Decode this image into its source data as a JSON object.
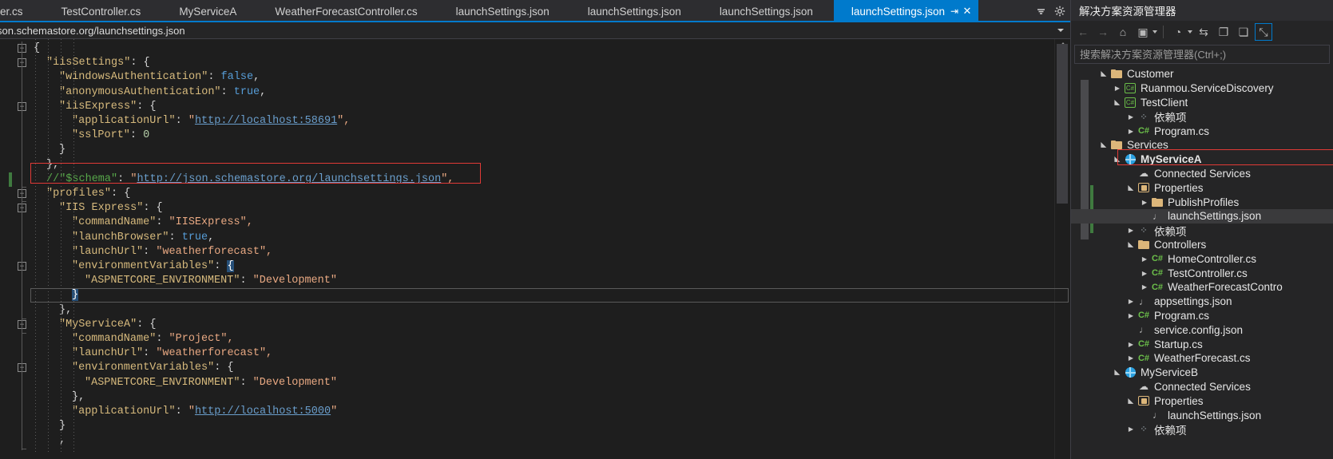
{
  "editor": {
    "tabs": [
      {
        "label": "ller.cs",
        "active": false,
        "truncated": true
      },
      {
        "label": "TestController.cs",
        "active": false
      },
      {
        "label": "MyServiceA",
        "active": false
      },
      {
        "label": "WeatherForecastController.cs",
        "active": false
      },
      {
        "label": "launchSettings.json",
        "active": false
      },
      {
        "label": "launchSettings.json",
        "active": false
      },
      {
        "label": "launchSettings.json",
        "active": false
      },
      {
        "label": "launchSettings.json",
        "active": true,
        "pin": "⇥",
        "close": "✕"
      }
    ],
    "tab_overflow_icon": "chevron-down-icon",
    "tab_settings_icon": "gear-icon",
    "url_tooltip": "son.schemastore.org/launchsettings.json",
    "code_lines": [
      {
        "fold": "open",
        "indent": 0,
        "tokens": [
          {
            "t": "{",
            "c": "t-punc"
          }
        ]
      },
      {
        "fold": "open",
        "indent": 1,
        "tokens": [
          {
            "t": "\"iisSettings\"",
            "c": "t-key"
          },
          {
            "t": ": {",
            "c": "t-punc"
          }
        ]
      },
      {
        "indent": 2,
        "tokens": [
          {
            "t": "\"windowsAuthentication\"",
            "c": "t-key"
          },
          {
            "t": ": ",
            "c": "t-punc"
          },
          {
            "t": "false",
            "c": "t-bool"
          },
          {
            "t": ",",
            "c": "t-punc"
          }
        ]
      },
      {
        "indent": 2,
        "tokens": [
          {
            "t": "\"anonymousAuthentication\"",
            "c": "t-key"
          },
          {
            "t": ": ",
            "c": "t-punc"
          },
          {
            "t": "true",
            "c": "t-bool"
          },
          {
            "t": ",",
            "c": "t-punc"
          }
        ]
      },
      {
        "fold": "open",
        "indent": 2,
        "tokens": [
          {
            "t": "\"iisExpress\"",
            "c": "t-key"
          },
          {
            "t": ": {",
            "c": "t-punc"
          }
        ]
      },
      {
        "indent": 3,
        "tokens": [
          {
            "t": "\"applicationUrl\"",
            "c": "t-key"
          },
          {
            "t": ": ",
            "c": "t-punc"
          },
          {
            "t": "\"",
            "c": "t-str"
          },
          {
            "t": "http://localhost:58691",
            "c": "t-link"
          },
          {
            "t": "\",",
            "c": "t-str"
          }
        ]
      },
      {
        "indent": 3,
        "tokens": [
          {
            "t": "\"sslPort\"",
            "c": "t-key"
          },
          {
            "t": ": ",
            "c": "t-punc"
          },
          {
            "t": "0",
            "c": "t-num"
          }
        ]
      },
      {
        "indent": 2,
        "tokens": [
          {
            "t": "}",
            "c": "t-punc"
          }
        ]
      },
      {
        "indent": 1,
        "tokens": [
          {
            "t": "},",
            "c": "t-punc"
          }
        ]
      },
      {
        "indent": 1,
        "changed": true,
        "tokens": [
          {
            "t": "//",
            "c": "t-comm"
          },
          {
            "t": "\"$schema\"",
            "c": "t-comm"
          },
          {
            "t": ": ",
            "c": "t-punc"
          },
          {
            "t": "\"",
            "c": "t-str"
          },
          {
            "t": "http://json.schemastore.org/launchsettings.json",
            "c": "t-link"
          },
          {
            "t": "\",",
            "c": "t-str"
          }
        ]
      },
      {
        "fold": "open",
        "indent": 1,
        "tokens": [
          {
            "t": "\"profiles\"",
            "c": "t-key"
          },
          {
            "t": ": {",
            "c": "t-punc"
          }
        ]
      },
      {
        "fold": "open",
        "indent": 2,
        "tokens": [
          {
            "t": "\"IIS Express\"",
            "c": "t-key"
          },
          {
            "t": ": {",
            "c": "t-punc"
          }
        ]
      },
      {
        "indent": 3,
        "tokens": [
          {
            "t": "\"commandName\"",
            "c": "t-key"
          },
          {
            "t": ": ",
            "c": "t-punc"
          },
          {
            "t": "\"IISExpress\",",
            "c": "t-str"
          }
        ]
      },
      {
        "indent": 3,
        "tokens": [
          {
            "t": "\"launchBrowser\"",
            "c": "t-key"
          },
          {
            "t": ": ",
            "c": "t-punc"
          },
          {
            "t": "true",
            "c": "t-bool"
          },
          {
            "t": ",",
            "c": "t-punc"
          }
        ]
      },
      {
        "indent": 3,
        "tokens": [
          {
            "t": "\"launchUrl\"",
            "c": "t-key"
          },
          {
            "t": ": ",
            "c": "t-punc"
          },
          {
            "t": "\"weatherforecast\",",
            "c": "t-str"
          }
        ]
      },
      {
        "fold": "open",
        "indent": 3,
        "tokens": [
          {
            "t": "\"environmentVariables\"",
            "c": "t-key"
          },
          {
            "t": ": ",
            "c": "t-punc"
          },
          {
            "t": "{",
            "c": "t-brace-hl"
          }
        ]
      },
      {
        "indent": 4,
        "tokens": [
          {
            "t": "\"ASPNETCORE_ENVIRONMENT\"",
            "c": "t-key"
          },
          {
            "t": ": ",
            "c": "t-punc"
          },
          {
            "t": "\"Development\"",
            "c": "t-str"
          }
        ]
      },
      {
        "indent": 3,
        "current": true,
        "tokens": [
          {
            "t": "}",
            "c": "t-brace-hl"
          }
        ]
      },
      {
        "indent": 2,
        "tokens": [
          {
            "t": "},",
            "c": "t-punc"
          }
        ]
      },
      {
        "fold": "open",
        "indent": 2,
        "tokens": [
          {
            "t": "\"MyServiceA\"",
            "c": "t-key"
          },
          {
            "t": ": {",
            "c": "t-punc"
          }
        ]
      },
      {
        "indent": 3,
        "tokens": [
          {
            "t": "\"commandName\"",
            "c": "t-key"
          },
          {
            "t": ": ",
            "c": "t-punc"
          },
          {
            "t": "\"Project\",",
            "c": "t-str"
          }
        ]
      },
      {
        "indent": 3,
        "tokens": [
          {
            "t": "\"launchUrl\"",
            "c": "t-key"
          },
          {
            "t": ": ",
            "c": "t-punc"
          },
          {
            "t": "\"weatherforecast\",",
            "c": "t-str"
          }
        ]
      },
      {
        "fold": "open",
        "indent": 3,
        "tokens": [
          {
            "t": "\"environmentVariables\"",
            "c": "t-key"
          },
          {
            "t": ": {",
            "c": "t-punc"
          }
        ]
      },
      {
        "indent": 4,
        "tokens": [
          {
            "t": "\"ASPNETCORE_ENVIRONMENT\"",
            "c": "t-key"
          },
          {
            "t": ": ",
            "c": "t-punc"
          },
          {
            "t": "\"Development\"",
            "c": "t-str"
          }
        ]
      },
      {
        "indent": 3,
        "tokens": [
          {
            "t": "},",
            "c": "t-punc"
          }
        ]
      },
      {
        "indent": 3,
        "tokens": [
          {
            "t": "\"applicationUrl\"",
            "c": "t-key"
          },
          {
            "t": ": ",
            "c": "t-punc"
          },
          {
            "t": "\"",
            "c": "t-str"
          },
          {
            "t": "http://localhost:5000",
            "c": "t-link"
          },
          {
            "t": "\"",
            "c": "t-str"
          }
        ]
      },
      {
        "indent": 2,
        "tokens": [
          {
            "t": "}",
            "c": "t-punc"
          }
        ]
      },
      {
        "indent": 2,
        "tokens": [
          {
            "t": ",",
            "c": "t-punc"
          }
        ]
      }
    ]
  },
  "solution_explorer": {
    "title": "解决方案资源管理器",
    "search_placeholder": "搜索解决方案资源管理器(Ctrl+;)",
    "toolbar": [
      {
        "name": "back-arrow-icon",
        "glyph": "←",
        "disabled": true
      },
      {
        "name": "forward-arrow-icon",
        "glyph": "→",
        "disabled": true
      },
      {
        "name": "home-icon",
        "glyph": "⌂",
        "disabled": false
      },
      {
        "name": "show-all-files-icon",
        "glyph": "▣",
        "disabled": false
      },
      {
        "name": "show-all-files-caret-icon",
        "glyph": "▾",
        "caret": true
      },
      {
        "name": "pending-changes-icon",
        "glyph": "◔",
        "disabled": false
      },
      {
        "name": "pending-changes-caret-icon",
        "glyph": "▾",
        "caret": true
      },
      {
        "name": "sync-with-active-document-icon",
        "glyph": "⇆",
        "disabled": false
      },
      {
        "name": "refresh-icon",
        "glyph": "❐",
        "disabled": false
      },
      {
        "name": "collapse-all-icon",
        "glyph": "❏",
        "disabled": false
      },
      {
        "name": "properties-icon",
        "glyph": "⤡",
        "boxed": true
      }
    ],
    "tree": [
      {
        "depth": 0,
        "arrow": "open",
        "icon": "folder",
        "label": "Customer"
      },
      {
        "depth": 1,
        "arrow": "closed",
        "icon": "cs-proj",
        "label": "Ruanmou.ServiceDiscovery"
      },
      {
        "depth": 1,
        "arrow": "open",
        "icon": "cs-proj",
        "label": "TestClient"
      },
      {
        "depth": 2,
        "arrow": "closed",
        "icon": "deps",
        "label": "依赖项"
      },
      {
        "depth": 2,
        "arrow": "closed",
        "icon": "cs-file",
        "label": "Program.cs"
      },
      {
        "depth": 0,
        "arrow": "open",
        "icon": "folder",
        "label": "Services"
      },
      {
        "depth": 1,
        "arrow": "open",
        "icon": "web-proj",
        "label": "MyServiceA",
        "bold": true
      },
      {
        "depth": 2,
        "arrow": "none",
        "icon": "cloud",
        "label": "Connected Services"
      },
      {
        "depth": 2,
        "arrow": "open",
        "icon": "props",
        "label": "Properties"
      },
      {
        "depth": 3,
        "arrow": "closed",
        "icon": "folder",
        "label": "PublishProfiles"
      },
      {
        "depth": 3,
        "arrow": "none",
        "icon": "json",
        "label": "launchSettings.json",
        "selected": true,
        "boxed": true
      },
      {
        "depth": 2,
        "arrow": "closed",
        "icon": "deps",
        "label": "依赖项"
      },
      {
        "depth": 2,
        "arrow": "open",
        "icon": "folder",
        "label": "Controllers"
      },
      {
        "depth": 3,
        "arrow": "closed",
        "icon": "cs-file",
        "label": "HomeController.cs"
      },
      {
        "depth": 3,
        "arrow": "closed",
        "icon": "cs-file",
        "label": "TestController.cs"
      },
      {
        "depth": 3,
        "arrow": "closed",
        "icon": "cs-file",
        "label": "WeatherForecastContro"
      },
      {
        "depth": 2,
        "arrow": "closed",
        "icon": "json",
        "label": "appsettings.json"
      },
      {
        "depth": 2,
        "arrow": "closed",
        "icon": "cs-file",
        "label": "Program.cs"
      },
      {
        "depth": 2,
        "arrow": "none",
        "icon": "json",
        "label": "service.config.json"
      },
      {
        "depth": 2,
        "arrow": "closed",
        "icon": "cs-file",
        "label": "Startup.cs"
      },
      {
        "depth": 2,
        "arrow": "closed",
        "icon": "cs-file",
        "label": "WeatherForecast.cs"
      },
      {
        "depth": 1,
        "arrow": "open",
        "icon": "web-proj",
        "label": "MyServiceB"
      },
      {
        "depth": 2,
        "arrow": "none",
        "icon": "cloud",
        "label": "Connected Services"
      },
      {
        "depth": 2,
        "arrow": "open",
        "icon": "props",
        "label": "Properties"
      },
      {
        "depth": 3,
        "arrow": "none",
        "icon": "json",
        "label": "launchSettings.json"
      },
      {
        "depth": 2,
        "arrow": "closed",
        "icon": "deps",
        "label": "依赖项"
      }
    ]
  },
  "colors": {
    "accent": "#007acc",
    "editor_bg": "#1e1e1e",
    "panel_bg": "#252526",
    "chrome_bg": "#2d2d30",
    "highlight_red": "#e03a36",
    "json_key": "#d7ba7d",
    "json_string": "#e8a882",
    "json_bool": "#569cd6",
    "json_comment": "#57a64a",
    "json_link": "#6a9ecc"
  }
}
